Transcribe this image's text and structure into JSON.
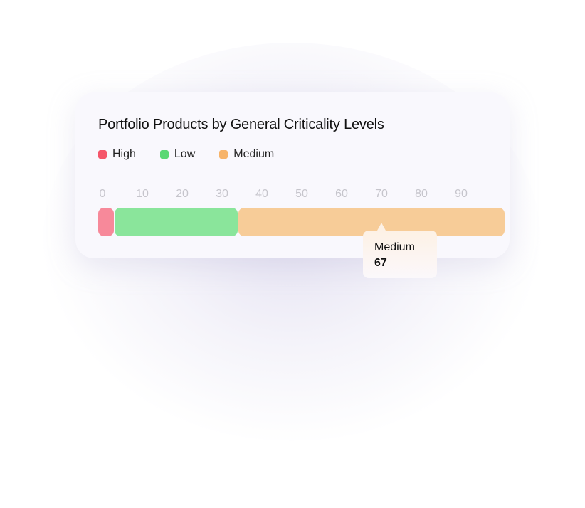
{
  "chart_data": {
    "type": "bar",
    "orientation": "horizontal-stacked",
    "title": "Portfolio Products by General Criticality Levels",
    "categories": [
      "High",
      "Low",
      "Medium"
    ],
    "values": [
      4,
      31,
      67
    ],
    "colors": {
      "High": "#f5566a",
      "Low": "#5ad874",
      "Medium": "#f7b46a"
    },
    "bar_colors": {
      "High": "#f7899a",
      "Low": "#8ae59b",
      "Medium": "#f7cc98"
    },
    "x_ticks": [
      "0",
      "10",
      "20",
      "30",
      "40",
      "50",
      "60",
      "70",
      "80",
      "90"
    ],
    "xlim": [
      0,
      102
    ],
    "legend": [
      "High",
      "Low",
      "Medium"
    ],
    "legend_position": "top-left",
    "grid": false,
    "tooltip": {
      "label": "Medium",
      "value": "67"
    }
  }
}
